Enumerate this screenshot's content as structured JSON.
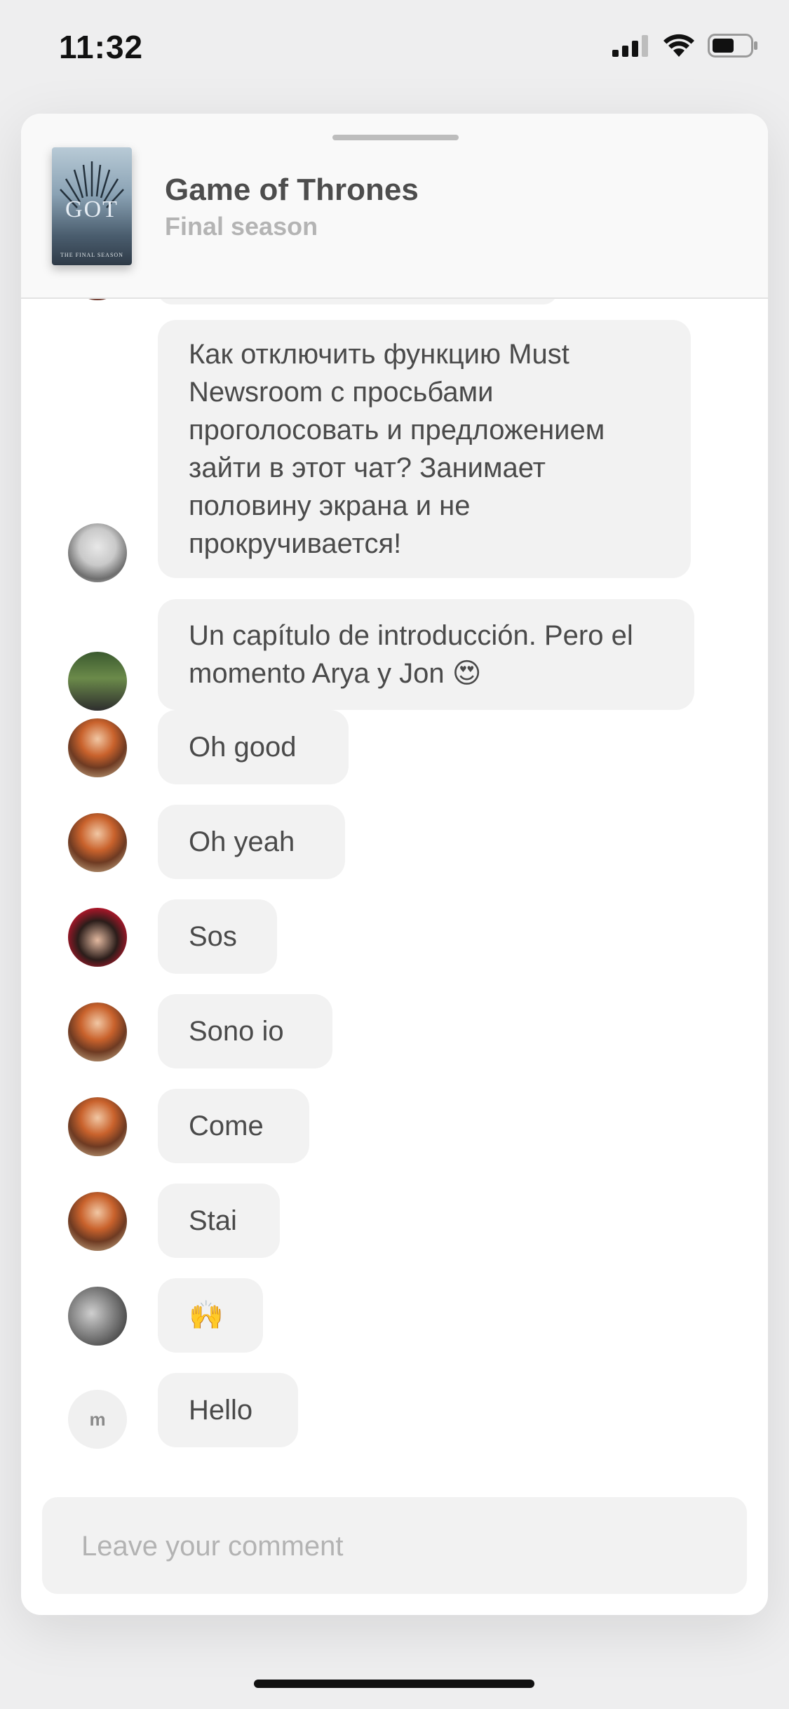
{
  "status_bar": {
    "time": "11:32"
  },
  "header": {
    "title": "Game of Thrones",
    "subtitle": "Final season",
    "poster_text": "GOT",
    "poster_sub": "THE FINAL SEASON"
  },
  "messages": [
    {
      "text": "Как отключить функцию Must Newsroom с просьбами проголосовать и предложением зайти в этот чат? Занимает половину экрана и не прокручивается!"
    },
    {
      "text": "Un capítulo de introducción. Pero el momento Arya y Jon 😍"
    },
    {
      "text": "Oh good"
    },
    {
      "text": "Oh yeah"
    },
    {
      "text": "Sos"
    },
    {
      "text": "Sono io"
    },
    {
      "text": "Come"
    },
    {
      "text": "Stai"
    },
    {
      "text": "🙌"
    },
    {
      "text": "Hello",
      "avatar_initial": "m"
    }
  ],
  "composer": {
    "placeholder": "Leave your comment"
  }
}
